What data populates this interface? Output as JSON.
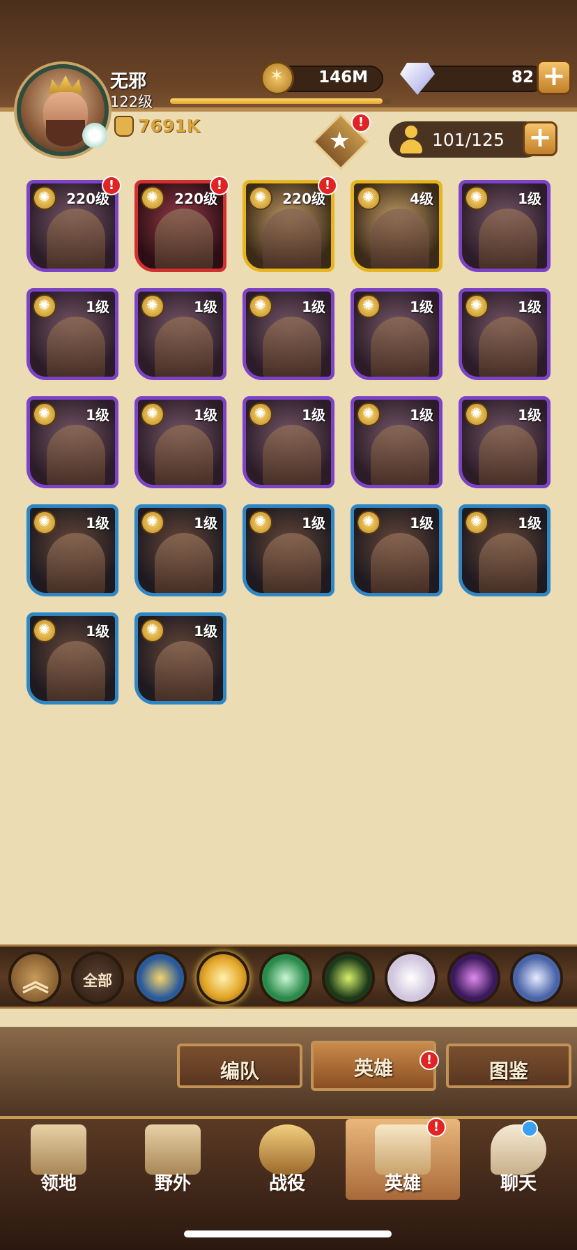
{
  "player": {
    "name": "无邪",
    "level": "122级",
    "power": "7691K",
    "xp_fraction": 0.96
  },
  "resources": {
    "gold": "146M",
    "gems": "82",
    "add_label": "+"
  },
  "roster": {
    "count": "101/125",
    "add_label": "+"
  },
  "notices": {
    "badge": "!"
  },
  "heroes": [
    {
      "level": "220级",
      "rarity": "purple",
      "alert": true
    },
    {
      "level": "220级",
      "rarity": "red",
      "alert": true
    },
    {
      "level": "220级",
      "rarity": "gold",
      "alert": true
    },
    {
      "level": "4级",
      "rarity": "gold",
      "alert": false
    },
    {
      "level": "1级",
      "rarity": "purple",
      "alert": false
    },
    {
      "level": "1级",
      "rarity": "purple",
      "alert": false
    },
    {
      "level": "1级",
      "rarity": "purple",
      "alert": false
    },
    {
      "level": "1级",
      "rarity": "purple",
      "alert": false
    },
    {
      "level": "1级",
      "rarity": "purple",
      "alert": false
    },
    {
      "level": "1级",
      "rarity": "purple",
      "alert": false
    },
    {
      "level": "1级",
      "rarity": "purple",
      "alert": false
    },
    {
      "level": "1级",
      "rarity": "purple",
      "alert": false
    },
    {
      "level": "1级",
      "rarity": "purple",
      "alert": false
    },
    {
      "level": "1级",
      "rarity": "purple",
      "alert": false
    },
    {
      "level": "1级",
      "rarity": "purple",
      "alert": false
    },
    {
      "level": "1级",
      "rarity": "blue",
      "alert": false
    },
    {
      "level": "1级",
      "rarity": "blue",
      "alert": false
    },
    {
      "level": "1级",
      "rarity": "blue",
      "alert": false
    },
    {
      "level": "1级",
      "rarity": "blue",
      "alert": false
    },
    {
      "level": "1级",
      "rarity": "blue",
      "alert": false
    },
    {
      "level": "1级",
      "rarity": "blue",
      "alert": false
    },
    {
      "level": "1级",
      "rarity": "blue",
      "alert": false
    }
  ],
  "filters": {
    "collapse_icon": "double-chevron-up-icon",
    "all_label": "全部",
    "factions": [
      "lightbearer-icon",
      "mauler-icon",
      "wilder-icon",
      "graveborn-icon",
      "celestial-icon",
      "hypogean-icon",
      "dimensional-icon"
    ]
  },
  "sub_tabs": [
    {
      "label": "编队",
      "active": false
    },
    {
      "label": "英雄",
      "active": true
    },
    {
      "label": "图鉴",
      "active": false
    }
  ],
  "bottom_nav": [
    {
      "label": "领地",
      "icon": "castle-icon"
    },
    {
      "label": "野外",
      "icon": "scroll-map-icon"
    },
    {
      "label": "战役",
      "icon": "sword-shield-icon"
    },
    {
      "label": "英雄",
      "icon": "helmet-icon"
    },
    {
      "label": "聊天",
      "icon": "chat-bubble-icon"
    }
  ],
  "colors": {
    "rarity_purple": "#7d43c6",
    "rarity_red": "#d03030",
    "rarity_gold": "#e6b520",
    "rarity_blue": "#2e86c4",
    "background": "#ecdcb4",
    "alert": "#e02424"
  }
}
